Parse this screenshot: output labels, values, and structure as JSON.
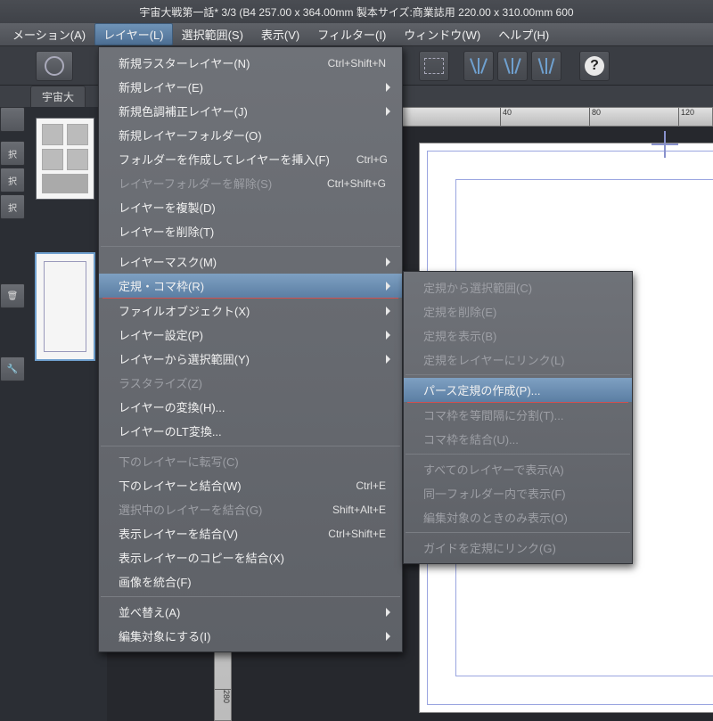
{
  "title": "宇宙大戦第一話* 3/3 (B4 257.00 x 364.00mm 製本サイズ:商業誌用 220.00 x 310.00mm 600",
  "menubar": {
    "items": [
      {
        "label": "メーション(A)"
      },
      {
        "label": "レイヤー(L)",
        "active": true
      },
      {
        "label": "選択範囲(S)"
      },
      {
        "label": "表示(V)"
      },
      {
        "label": "フィルター(I)"
      },
      {
        "label": "ウィンドウ(W)"
      },
      {
        "label": "ヘルプ(H)"
      }
    ]
  },
  "tab": {
    "label": "宇宙大"
  },
  "ruler": {
    "h": [
      "40",
      "80",
      "120"
    ],
    "v": [
      "280"
    ]
  },
  "toolside": {
    "labels": [
      "択",
      "択",
      "択"
    ]
  },
  "dropdown1": [
    {
      "type": "item",
      "label": "新規ラスターレイヤー(N)",
      "shortcut": "Ctrl+Shift+N"
    },
    {
      "type": "item",
      "label": "新規レイヤー(E)",
      "arrow": true
    },
    {
      "type": "item",
      "label": "新規色調補正レイヤー(J)",
      "arrow": true
    },
    {
      "type": "item",
      "label": "新規レイヤーフォルダー(O)"
    },
    {
      "type": "item",
      "label": "フォルダーを作成してレイヤーを挿入(F)",
      "shortcut": "Ctrl+G"
    },
    {
      "type": "item",
      "label": "レイヤーフォルダーを解除(S)",
      "shortcut": "Ctrl+Shift+G",
      "disabled": true
    },
    {
      "type": "item",
      "label": "レイヤーを複製(D)"
    },
    {
      "type": "item",
      "label": "レイヤーを削除(T)"
    },
    {
      "type": "sep"
    },
    {
      "type": "item",
      "label": "レイヤーマスク(M)",
      "arrow": true
    },
    {
      "type": "item",
      "label": "定規・コマ枠(R)",
      "arrow": true,
      "hl": true
    },
    {
      "type": "redline"
    },
    {
      "type": "item",
      "label": "ファイルオブジェクト(X)",
      "arrow": true
    },
    {
      "type": "item",
      "label": "レイヤー設定(P)",
      "arrow": true
    },
    {
      "type": "item",
      "label": "レイヤーから選択範囲(Y)",
      "arrow": true
    },
    {
      "type": "item",
      "label": "ラスタライズ(Z)",
      "disabled": true
    },
    {
      "type": "item",
      "label": "レイヤーの変換(H)..."
    },
    {
      "type": "item",
      "label": "レイヤーのLT変換..."
    },
    {
      "type": "sep"
    },
    {
      "type": "item",
      "label": "下のレイヤーに転写(C)",
      "disabled": true
    },
    {
      "type": "item",
      "label": "下のレイヤーと結合(W)",
      "shortcut": "Ctrl+E"
    },
    {
      "type": "item",
      "label": "選択中のレイヤーを結合(G)",
      "shortcut": "Shift+Alt+E",
      "disabled": true
    },
    {
      "type": "item",
      "label": "表示レイヤーを結合(V)",
      "shortcut": "Ctrl+Shift+E"
    },
    {
      "type": "item",
      "label": "表示レイヤーのコピーを結合(X)"
    },
    {
      "type": "item",
      "label": "画像を統合(F)"
    },
    {
      "type": "sep"
    },
    {
      "type": "item",
      "label": "並べ替え(A)",
      "arrow": true
    },
    {
      "type": "item",
      "label": "編集対象にする(I)",
      "arrow": true
    }
  ],
  "dropdown2": [
    {
      "type": "item",
      "label": "定規から選択範囲(C)",
      "disabled": true
    },
    {
      "type": "item",
      "label": "定規を削除(E)",
      "disabled": true
    },
    {
      "type": "item",
      "label": "定規を表示(B)",
      "disabled": true
    },
    {
      "type": "item",
      "label": "定規をレイヤーにリンク(L)",
      "disabled": true
    },
    {
      "type": "sep"
    },
    {
      "type": "item",
      "label": "パース定規の作成(P)...",
      "hl": true
    },
    {
      "type": "redline"
    },
    {
      "type": "item",
      "label": "コマ枠を等間隔に分割(T)...",
      "disabled": true
    },
    {
      "type": "item",
      "label": "コマ枠を結合(U)...",
      "disabled": true
    },
    {
      "type": "sep"
    },
    {
      "type": "item",
      "label": "すべてのレイヤーで表示(A)",
      "disabled": true
    },
    {
      "type": "item",
      "label": "同一フォルダー内で表示(F)",
      "disabled": true
    },
    {
      "type": "item",
      "label": "編集対象のときのみ表示(O)",
      "disabled": true
    },
    {
      "type": "sep"
    },
    {
      "type": "item",
      "label": "ガイドを定規にリンク(G)",
      "disabled": true
    }
  ]
}
